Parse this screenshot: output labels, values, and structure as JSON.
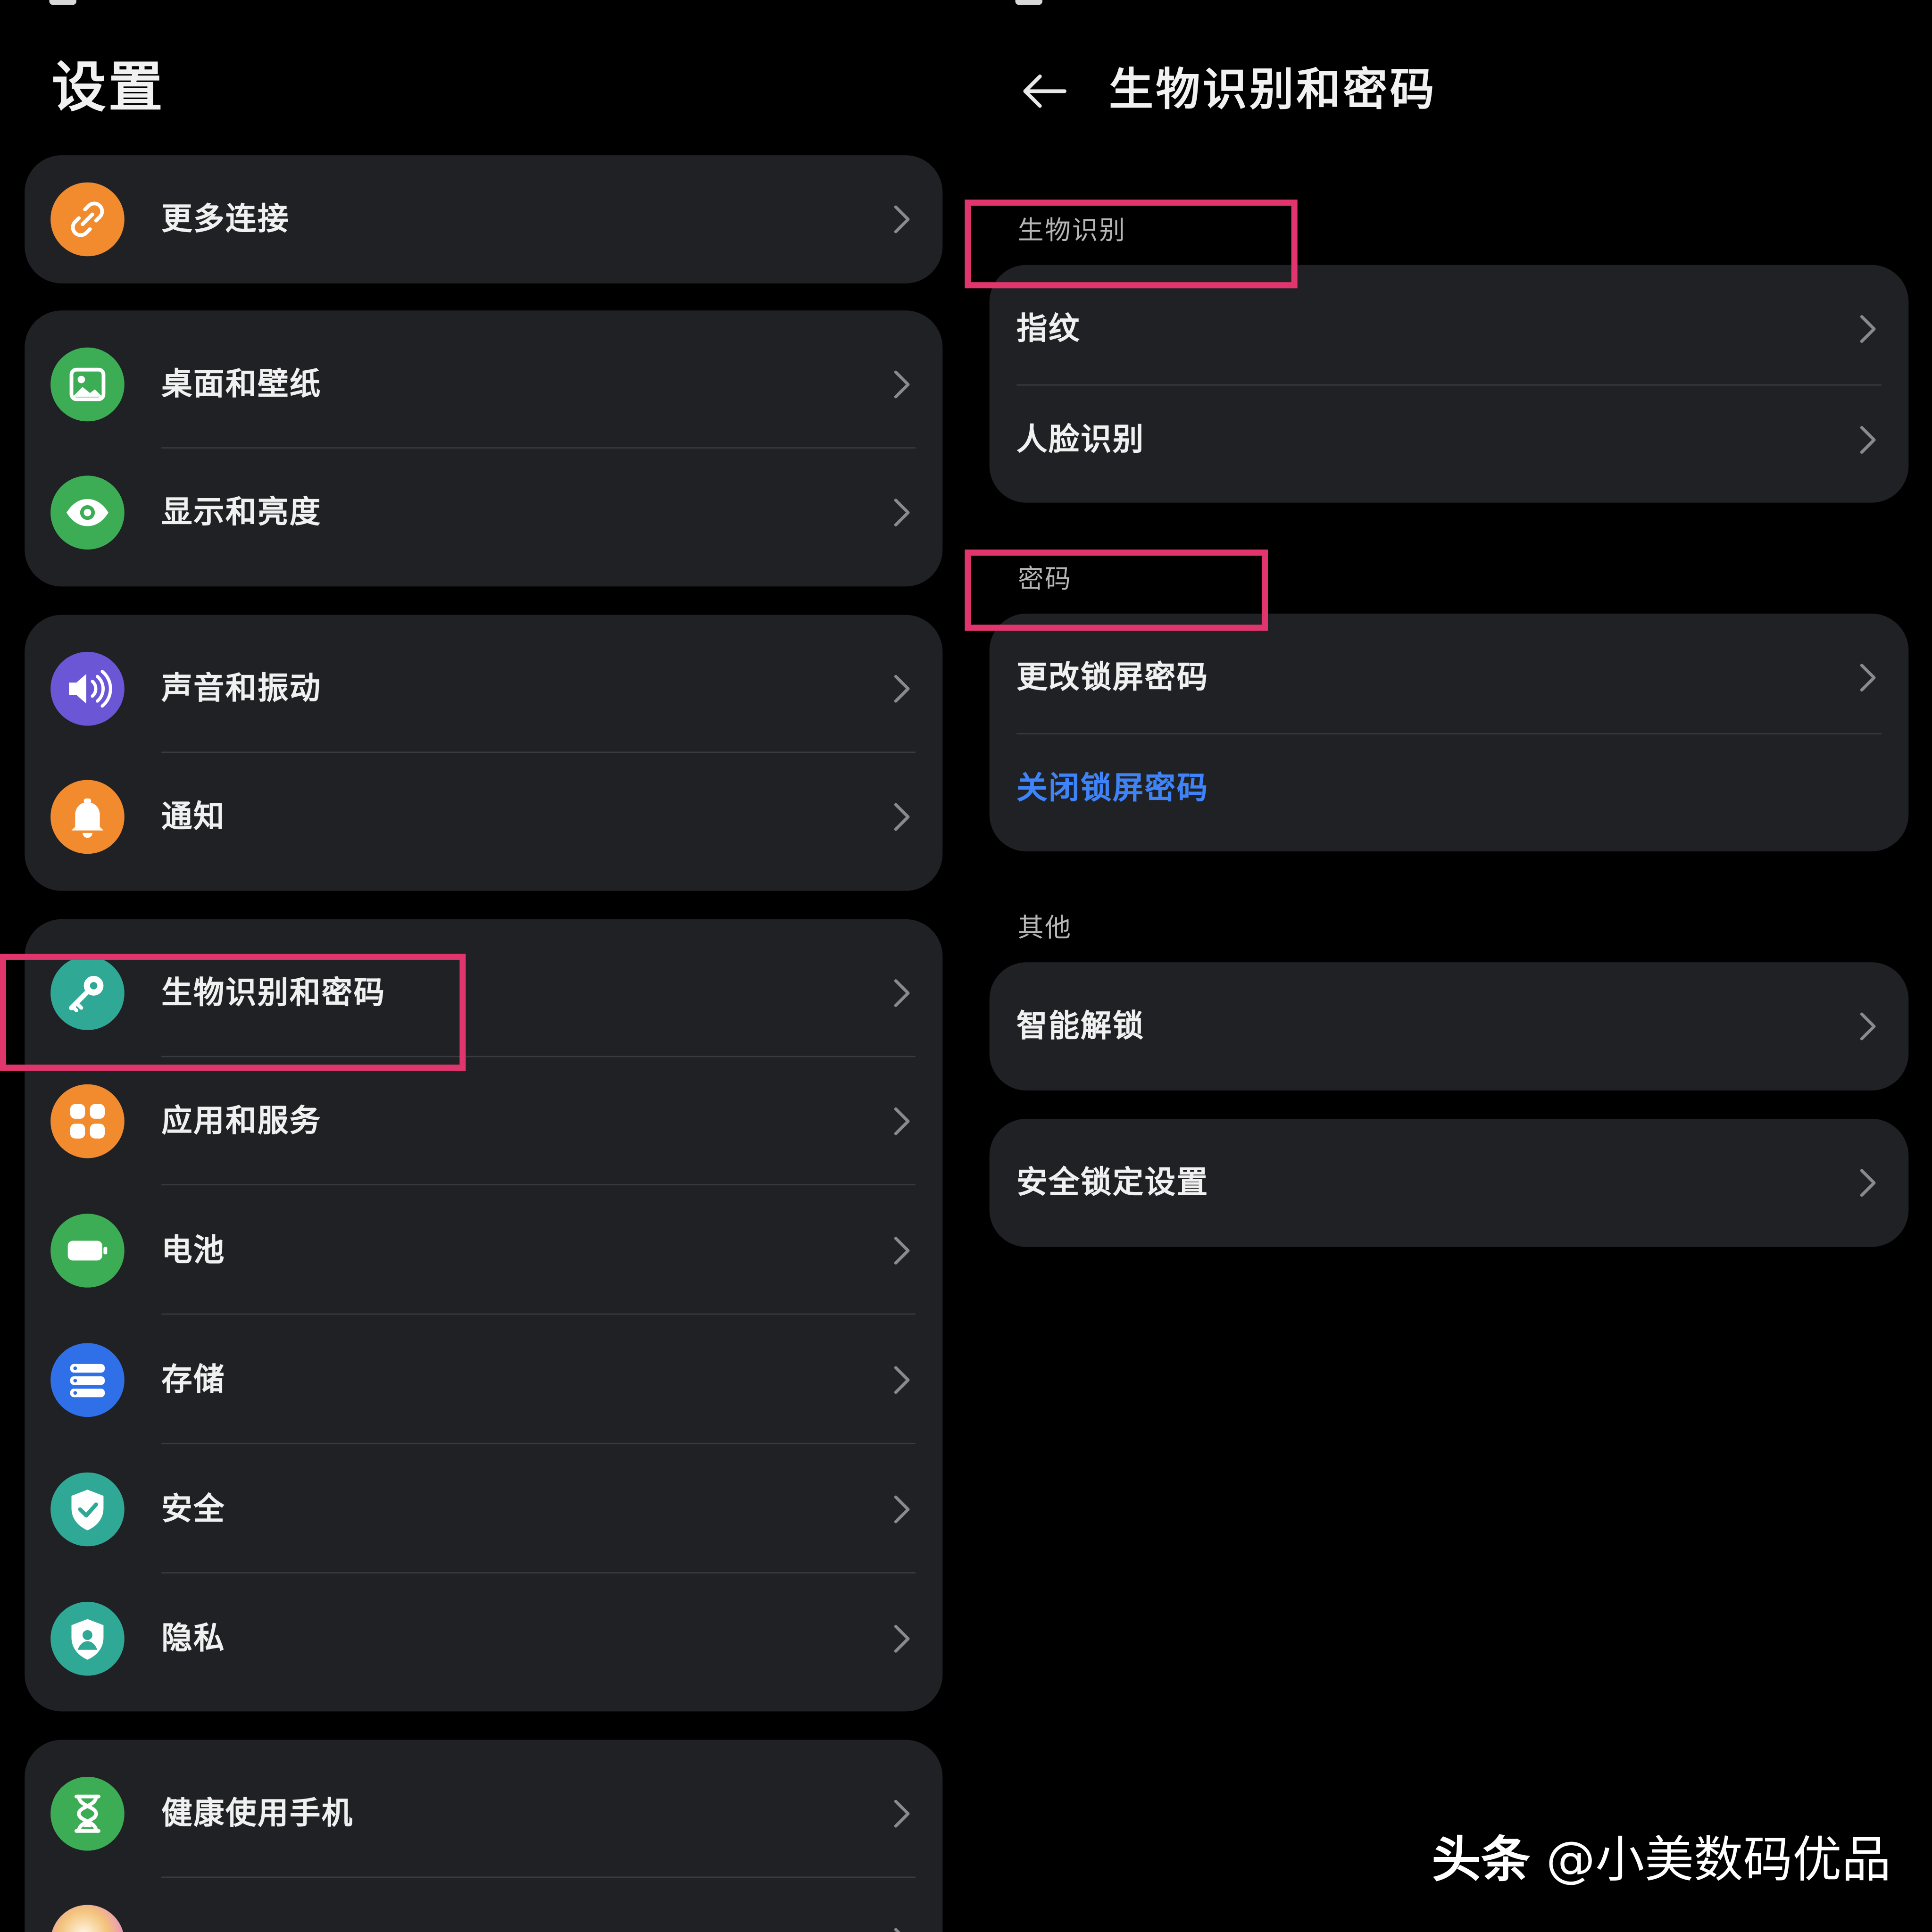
{
  "left": {
    "title": "设置",
    "groups": [
      [
        {
          "label": "更多连接",
          "icon": "link-icon",
          "color": "#f28a2e"
        }
      ],
      [
        {
          "label": "桌面和壁纸",
          "icon": "wallpaper-icon",
          "color": "#3dad55"
        },
        {
          "label": "显示和亮度",
          "icon": "eye-icon",
          "color": "#3dad55"
        }
      ],
      [
        {
          "label": "声音和振动",
          "icon": "speaker-icon",
          "color": "#6b57d6"
        },
        {
          "label": "通知",
          "icon": "bell-icon",
          "color": "#f28a2e"
        }
      ],
      [
        {
          "label": "生物识别和密码",
          "icon": "key-icon",
          "color": "#2fa896"
        },
        {
          "label": "应用和服务",
          "icon": "apps-grid-icon",
          "color": "#f28a2e"
        },
        {
          "label": "电池",
          "icon": "battery-icon",
          "color": "#3dad55"
        },
        {
          "label": "存储",
          "icon": "storage-icon",
          "color": "#2f6fe8"
        },
        {
          "label": "安全",
          "icon": "shield-check-icon",
          "color": "#2fa896"
        },
        {
          "label": "隐私",
          "icon": "privacy-shield-icon",
          "color": "#2fa896"
        }
      ],
      [
        {
          "label": "健康使用手机",
          "icon": "hourglass-icon",
          "color": "#3dad55"
        },
        {
          "label": "",
          "icon": "assistant-icon",
          "color": "#f3c37a"
        }
      ]
    ]
  },
  "right": {
    "title": "生物识别和密码",
    "sections": [
      {
        "header": "生物识别",
        "items": [
          {
            "label": "指纹"
          },
          {
            "label": "人脸识别"
          }
        ]
      },
      {
        "header": "密码",
        "items": [
          {
            "label": "更改锁屏密码"
          },
          {
            "label": "关闭锁屏密码",
            "link": true
          }
        ]
      },
      {
        "header": "其他",
        "items": [
          {
            "label": "智能解锁"
          }
        ]
      },
      {
        "header": "",
        "items": [
          {
            "label": "安全锁定设置"
          }
        ]
      }
    ]
  },
  "watermark": {
    "brand": "头条",
    "handle": "@小美数码优品"
  },
  "colors": {
    "background": "#000000",
    "card": "#202124",
    "highlight": "#e0356d",
    "link": "#3f83f8"
  }
}
